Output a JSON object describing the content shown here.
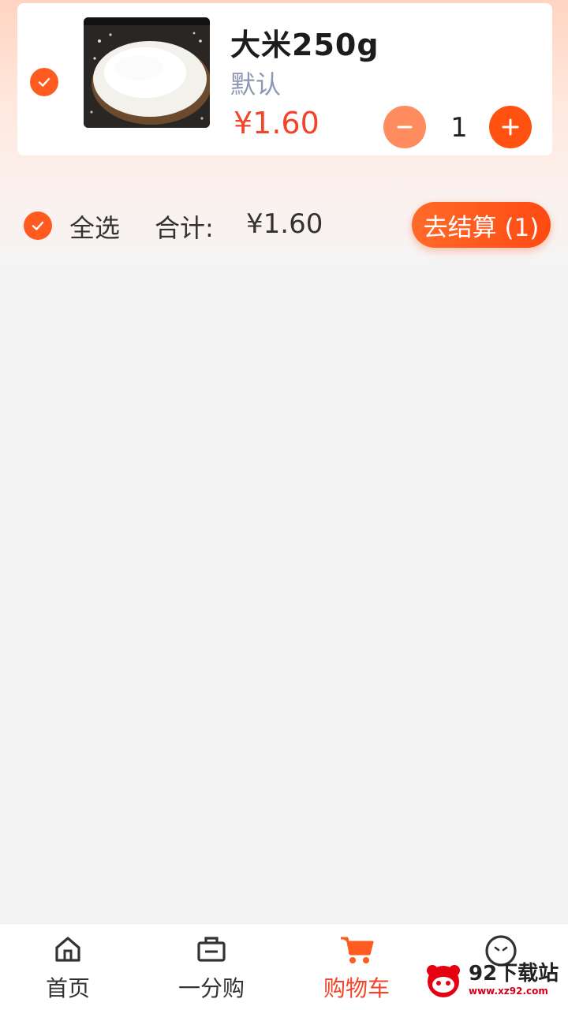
{
  "cart_item": {
    "name": "大米250g",
    "spec": "默认",
    "price": "¥1.60",
    "quantity": "1",
    "selected": true
  },
  "footer_bar": {
    "select_all_label": "全选",
    "total_label": "合计:",
    "total_amount": "¥1.60",
    "checkout_label": "去结算 (1)"
  },
  "tabbar": {
    "items": [
      {
        "label": "首页",
        "icon": "home-icon"
      },
      {
        "label": "一分购",
        "icon": "shop-icon"
      },
      {
        "label": "购物车",
        "icon": "cart-icon",
        "active": true
      },
      {
        "label": "",
        "icon": "profile-icon"
      }
    ]
  },
  "watermark": {
    "main": "92下载站",
    "sub": "www.xz92.com"
  },
  "colors": {
    "accent": "#ff5a1f",
    "price": "#f1442b",
    "spec": "#8d97b3"
  }
}
